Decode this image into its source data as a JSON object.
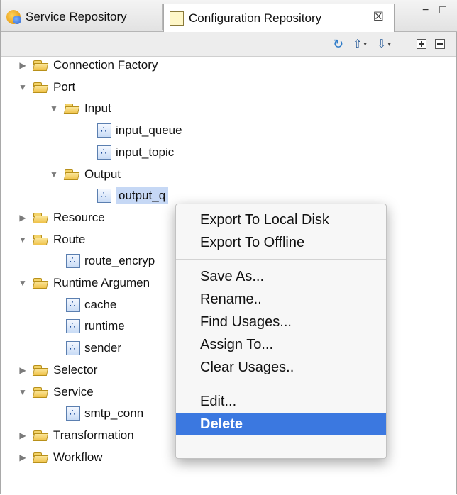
{
  "tabs": [
    {
      "label": "Service Repository",
      "icon": "service-repository-icon",
      "active": false
    },
    {
      "label": "Configuration Repository",
      "icon": "configuration-repository-icon",
      "active": true,
      "close_glyph": "☒"
    }
  ],
  "window_controls": {
    "minimize": "−",
    "maximize": "□"
  },
  "toolbar": {
    "buttons": [
      "refresh-icon",
      "export-icon",
      "import-icon",
      "expand-all-icon",
      "collapse-all-icon"
    ]
  },
  "tree": [
    {
      "label": "Connection Factory",
      "type": "folder",
      "expanded": false,
      "level": 0
    },
    {
      "label": "Port",
      "type": "folder",
      "expanded": true,
      "level": 0
    },
    {
      "label": "Input",
      "type": "folder",
      "expanded": true,
      "level": 1
    },
    {
      "label": "input_queue",
      "type": "item",
      "level": 2
    },
    {
      "label": "input_topic",
      "type": "item",
      "level": 2
    },
    {
      "label": "Output",
      "type": "folder",
      "expanded": true,
      "level": 1
    },
    {
      "label": "output_q",
      "type": "item",
      "level": 2,
      "selected": true
    },
    {
      "label": "Resource",
      "type": "folder",
      "expanded": false,
      "level": 0
    },
    {
      "label": "Route",
      "type": "folder",
      "expanded": true,
      "level": 0
    },
    {
      "label": "route_encryp",
      "type": "item",
      "level": 1
    },
    {
      "label": "Runtime Argumen",
      "type": "folder",
      "expanded": true,
      "level": 0
    },
    {
      "label": "cache",
      "type": "item",
      "level": 1
    },
    {
      "label": "runtime",
      "type": "item",
      "level": 1
    },
    {
      "label": "sender",
      "type": "item",
      "level": 1
    },
    {
      "label": "Selector",
      "type": "folder",
      "expanded": false,
      "level": 0
    },
    {
      "label": "Service",
      "type": "folder",
      "expanded": true,
      "level": 0
    },
    {
      "label": "smtp_conn",
      "type": "item",
      "level": 1
    },
    {
      "label": "Transformation",
      "type": "folder",
      "expanded": false,
      "level": 0
    },
    {
      "label": "Workflow",
      "type": "folder",
      "expanded": false,
      "level": 0
    }
  ],
  "context_menu": {
    "groups": [
      [
        "Export To Local Disk",
        "Export To Offline"
      ],
      [
        "Save As...",
        "Rename..",
        "Find Usages...",
        "Assign To...",
        "Clear Usages.."
      ],
      [
        "Edit...",
        "Delete"
      ]
    ],
    "highlighted": "Delete"
  },
  "colors": {
    "selection": "#c6d8f5",
    "menu_highlight": "#3b78e0"
  }
}
